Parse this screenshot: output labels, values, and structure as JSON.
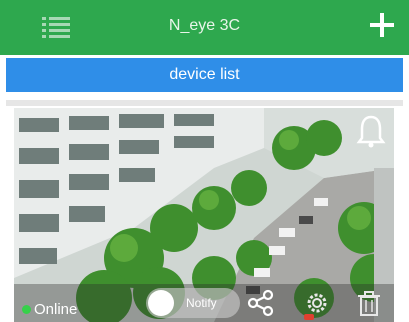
{
  "header": {
    "title": "N_eye 3C",
    "menu_icon": "list-icon",
    "add_icon": "plus-icon",
    "bg_color": "#2ea84e"
  },
  "device_list": {
    "label": "device list",
    "bg_color": "#2f8ee8"
  },
  "camera": {
    "status": "Online",
    "status_color": "#36d14a",
    "toggle_label": "Notify",
    "icons": [
      "bell-icon",
      "share-icon",
      "settings-icon",
      "delete-icon"
    ]
  }
}
